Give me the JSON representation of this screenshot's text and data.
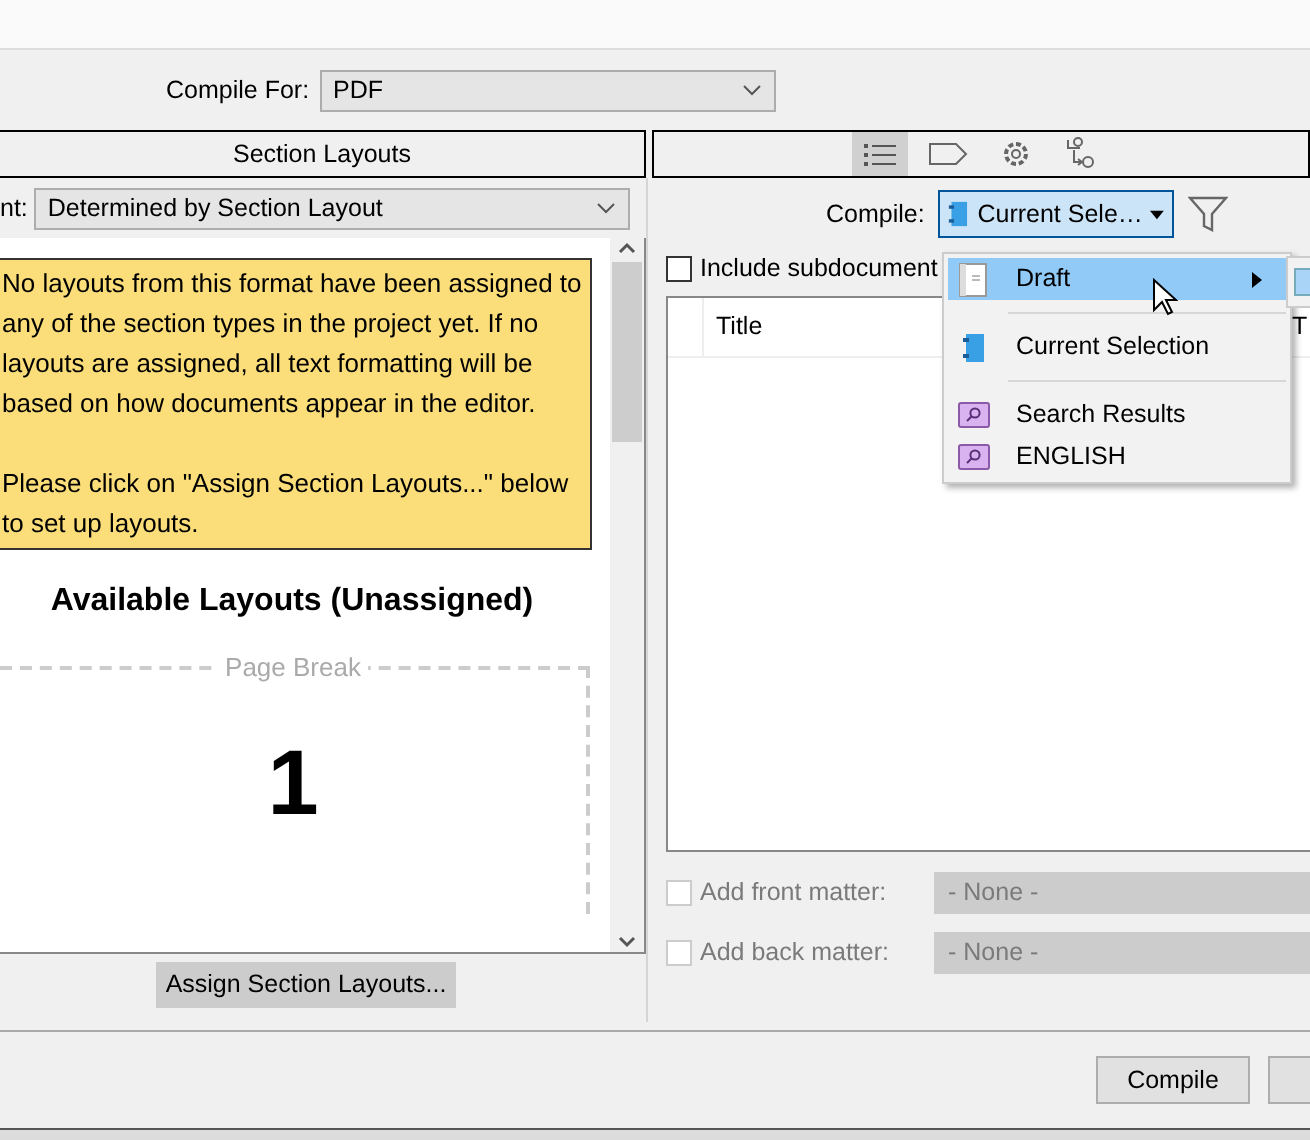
{
  "compile_for": {
    "label": "Compile For:",
    "value": "PDF"
  },
  "left_tab": {
    "label": "Section Layouts"
  },
  "right_tabs": [
    {
      "kind": "list",
      "selected": true
    },
    {
      "kind": "tag",
      "selected": false
    },
    {
      "kind": "gear",
      "selected": false
    },
    {
      "kind": "replace",
      "selected": false
    }
  ],
  "assignment": {
    "label": "nt:",
    "value": "Determined by Section Layout"
  },
  "notice": [
    "No layouts from this format have been assigned to any of the section types in the project yet. If no layouts are assigned, all text formatting will be based on how documents appear in the editor.",
    "Please click on \"Assign Section Layouts...\" below to set up layouts."
  ],
  "available_heading": "Available Layouts (Unassigned)",
  "layout_preview": {
    "legend": "Page Break",
    "number": "1"
  },
  "assign_button": "Assign Section Layouts...",
  "compile_source": {
    "label": "Compile:",
    "value": "Current Sele…"
  },
  "include_subdocuments": {
    "label": "Include subdocument",
    "checked": false
  },
  "table": {
    "columns": [
      "Title",
      "T"
    ]
  },
  "menu": [
    {
      "kind": "draft",
      "label": "Draft",
      "selected": true,
      "submenu": true
    },
    {
      "kind": "separator"
    },
    {
      "kind": "binder",
      "label": "Current Selection",
      "selected": false,
      "submenu": false
    },
    {
      "kind": "separator"
    },
    {
      "kind": "search",
      "label": "Search Results",
      "selected": false,
      "submenu": false
    },
    {
      "kind": "search",
      "label": "ENGLISH",
      "selected": false,
      "submenu": false
    }
  ],
  "matter": [
    {
      "label": "Add front matter:",
      "checked": false,
      "disabled": true,
      "value": "- None -"
    },
    {
      "label": "Add back matter:",
      "checked": false,
      "disabled": true,
      "value": "- None -"
    }
  ],
  "buttons": [
    {
      "label": "Compile"
    }
  ]
}
